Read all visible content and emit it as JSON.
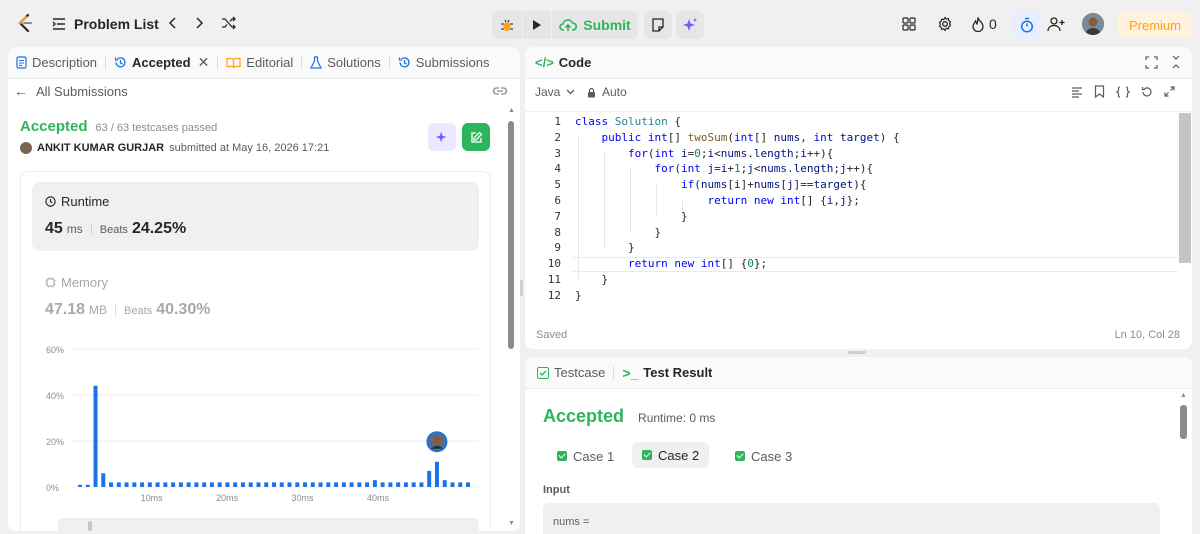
{
  "topbar": {
    "problem_list": "Problem List",
    "submit": "Submit",
    "streak_count": "0",
    "premium": "Premium"
  },
  "left": {
    "tabs": [
      {
        "label": "Description"
      },
      {
        "label": "Accepted"
      },
      {
        "label": "Editorial"
      },
      {
        "label": "Solutions"
      },
      {
        "label": "Submissions"
      }
    ],
    "back_label": "All Submissions",
    "status": "Accepted",
    "testcases": "63 / 63 testcases passed",
    "author": "ANKIT KUMAR GURJAR",
    "submitted_text": "submitted at May 16, 2026 17:21",
    "runtime_label": "Runtime",
    "runtime_value": "45",
    "runtime_unit": "ms",
    "runtime_beats_label": "Beats",
    "runtime_beats": "24.25%",
    "memory_label": "Memory",
    "memory_value": "47.18",
    "memory_unit": "MB",
    "memory_beats_label": "Beats",
    "memory_beats": "40.30%"
  },
  "chart_data": {
    "type": "bar",
    "y_ticks": [
      "60%",
      "40%",
      "20%",
      "0%"
    ],
    "x_ticks": [
      "10ms",
      "20ms",
      "30ms",
      "40ms"
    ],
    "ylim": [
      0,
      60
    ],
    "values": [
      1,
      1,
      44,
      6,
      2,
      2,
      2,
      2,
      2,
      2,
      2,
      2,
      2,
      2,
      2,
      2,
      2,
      2,
      2,
      2,
      2,
      2,
      2,
      2,
      2,
      2,
      2,
      2,
      2,
      2,
      2,
      2,
      2,
      2,
      2,
      2,
      2,
      2,
      3,
      2,
      2,
      2,
      2,
      2,
      2,
      7,
      11,
      3,
      2,
      2,
      2
    ],
    "highlight_index": 46,
    "colors": {
      "bar": "#1a73e8"
    }
  },
  "code": {
    "title": "Code",
    "language": "Java",
    "mode": "Auto",
    "status": "Saved",
    "position": "Ln 10, Col 28",
    "lines": [
      "class Solution {",
      "    public int[] twoSum(int[] nums, int target) {",
      "        for(int i=0;i<nums.length;i++){",
      "            for(int j=i+1;j<nums.length;j++){",
      "                if(nums[i]+nums[j]==target){",
      "                    return new int[] {i,j};",
      "                }",
      "            }",
      "        }",
      "        return new int[] {0};",
      "    }",
      "}"
    ]
  },
  "result": {
    "tab_testcase": "Testcase",
    "tab_result": "Test Result",
    "status": "Accepted",
    "runtime": "Runtime: 0 ms",
    "cases": [
      "Case 1",
      "Case 2",
      "Case 3"
    ],
    "input_label": "Input",
    "input_first": "nums ="
  },
  "colors": {
    "accent_green": "#2db55d",
    "accent_orange": "#ffa116",
    "premium_bg": "#fff3dd"
  }
}
